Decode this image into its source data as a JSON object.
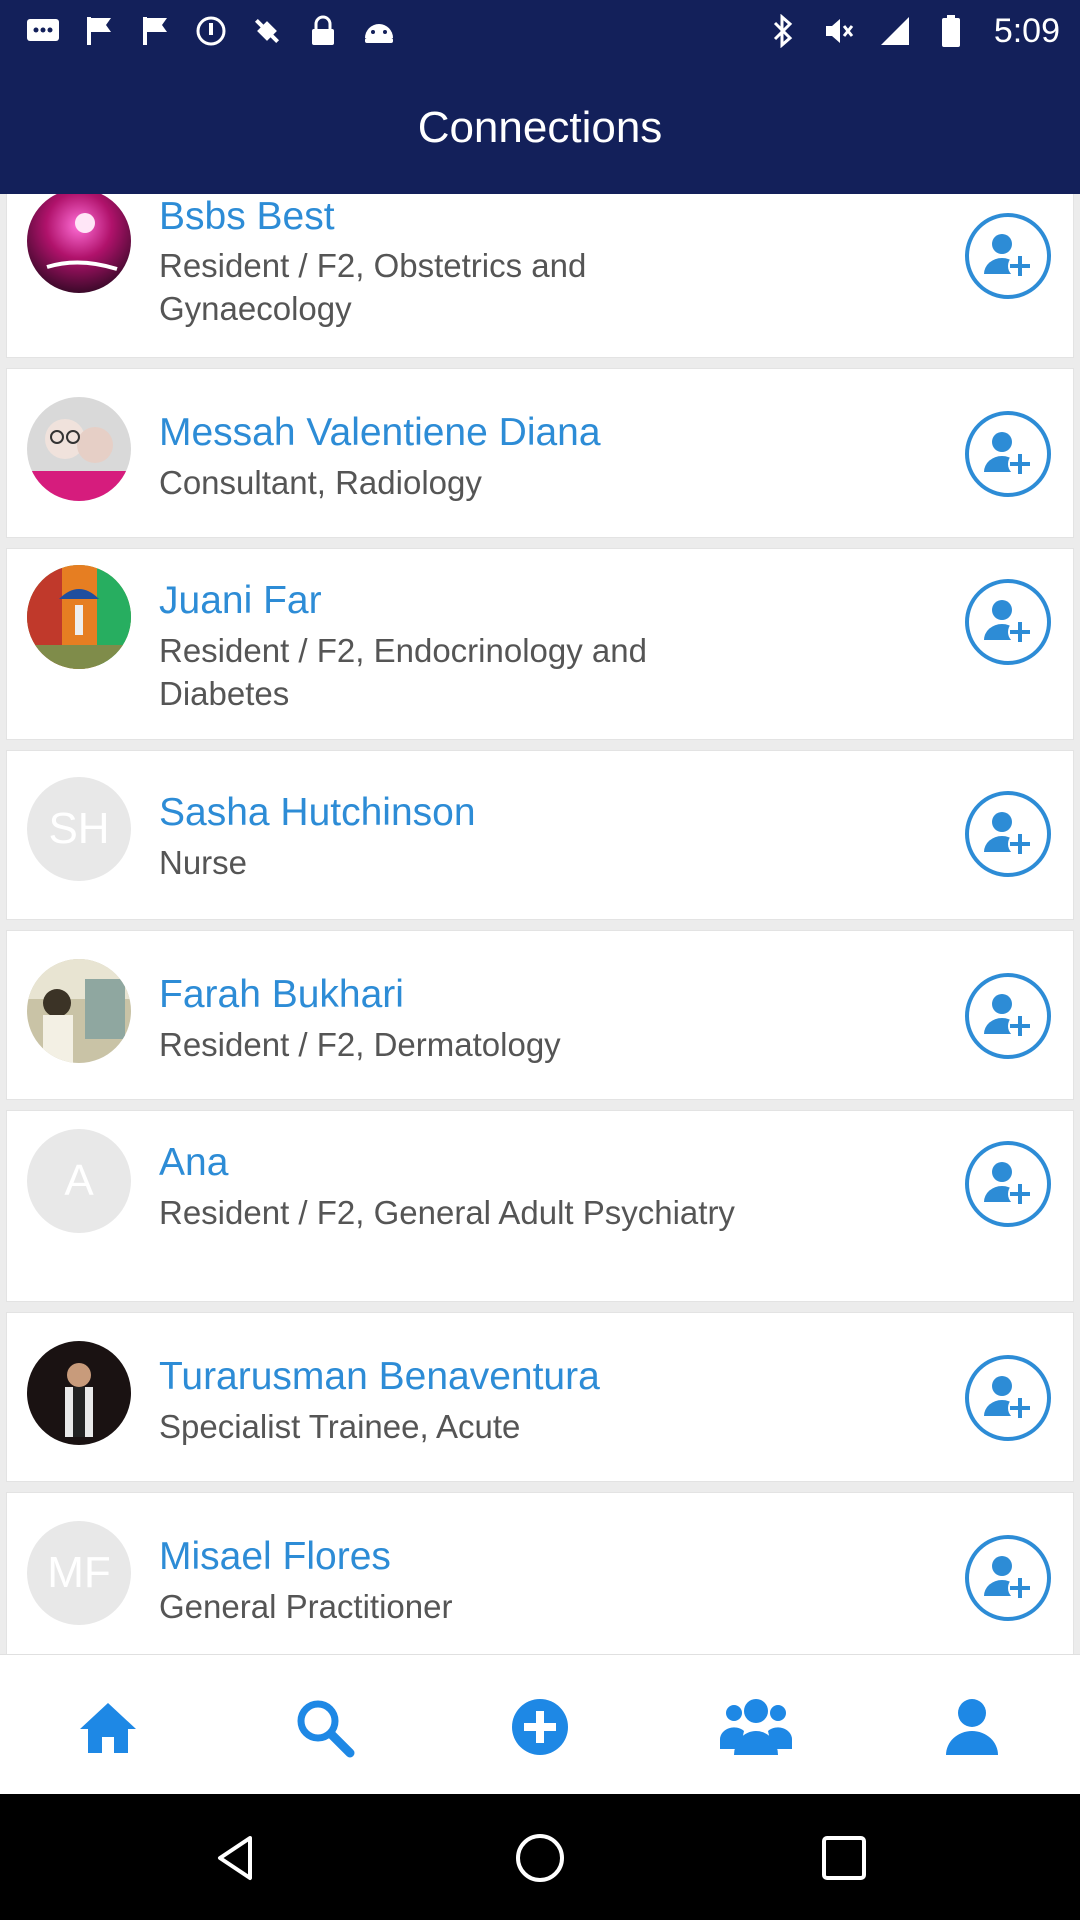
{
  "status_bar": {
    "time": "5:09",
    "icons": [
      "message-icon",
      "flag-icon",
      "flag-icon",
      "circle-dot-icon",
      "fake-gps-icon",
      "lock-icon",
      "android-icon",
      "bluetooth-icon",
      "mute-icon",
      "signal-icon",
      "battery-icon"
    ]
  },
  "header": {
    "title": "Connections"
  },
  "connections": [
    {
      "name": "Bsbs Best",
      "role": "Resident / F2, Obstetrics and Gynaecology",
      "avatar": "photo",
      "initials": ""
    },
    {
      "name": "Messah Valentiene Diana",
      "role": "Consultant, Radiology",
      "avatar": "photo",
      "initials": ""
    },
    {
      "name": "Juani Far",
      "role": "Resident / F2, Endocrinology and Diabetes",
      "avatar": "photo",
      "initials": ""
    },
    {
      "name": "Sasha Hutchinson",
      "role": "Nurse",
      "avatar": "initials",
      "initials": "SH"
    },
    {
      "name": "Farah Bukhari",
      "role": "Resident / F2, Dermatology",
      "avatar": "photo",
      "initials": ""
    },
    {
      "name": "Ana",
      "role": "Resident / F2, General Adult Psychiatry",
      "avatar": "initials",
      "initials": "A"
    },
    {
      "name": "Turarusman Benaventura",
      "role": "Specialist Trainee, Acute",
      "avatar": "photo",
      "initials": ""
    },
    {
      "name": "Misael Flores",
      "role": "General Practitioner",
      "avatar": "initials",
      "initials": "MF"
    }
  ],
  "tabs": [
    {
      "icon": "home-icon"
    },
    {
      "icon": "search-icon"
    },
    {
      "icon": "add-circle-icon"
    },
    {
      "icon": "users-icon"
    },
    {
      "icon": "user-icon"
    }
  ],
  "colors": {
    "header_bg": "#13205a",
    "accent": "#2d8cd6",
    "tab_accent": "#1e88e5",
    "list_bg": "#ececec"
  }
}
